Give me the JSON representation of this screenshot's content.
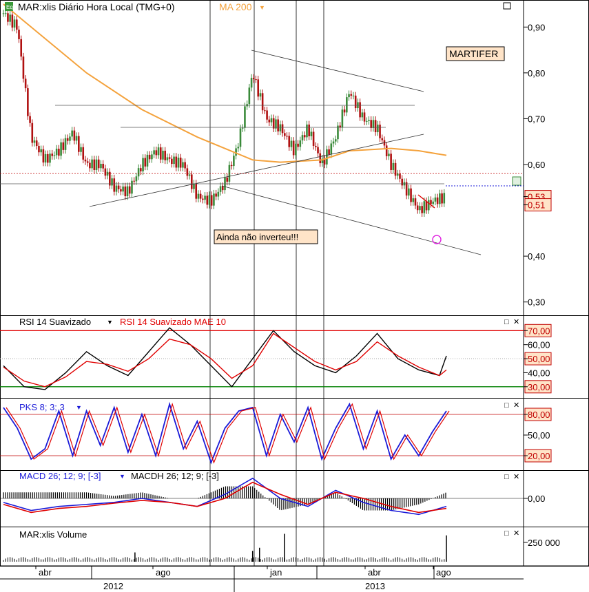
{
  "colors": {
    "background": "#ffffff",
    "axis": "#000000",
    "ma_line": "#f4a23c",
    "rsi": "#000000",
    "rsi_ma": "#e00000",
    "stoch_k": "#1a1ad8",
    "stoch_d": "#e00000",
    "macd": "#1a1ad8",
    "macd_signal": "#e00000",
    "level_high": "#e00000",
    "level_low": "#008000",
    "label_box": "#ffe4c8",
    "up_candle": "#3a8a3a",
    "down_candle": "#b01010"
  },
  "header": {
    "badge": "Eq",
    "title": "MAR:xlis Diário Hora Local (TMG+0)",
    "ma_label": "MA 200",
    "ticker_label": "MARTIFER",
    "note_label": "Ainda não inverteu!!!"
  },
  "panels": {
    "rsi": {
      "label1": "RSI 14 Suavizado",
      "label2": "RSI 14 Suavizado MAE 10"
    },
    "stoch": {
      "label": "PKS 8; 3; 3"
    },
    "macd": {
      "label1": "MACD 26; 12; 9; [-3]",
      "label2": "MACDH 26; 12; 9; [-3]"
    },
    "volume": {
      "label": "MAR:xlis Volume"
    }
  },
  "x_axis": {
    "months": [
      "abr",
      "ago",
      "jan",
      "abr",
      "ago"
    ],
    "years": [
      "2012",
      "2013"
    ]
  },
  "chart_data": [
    {
      "type": "candlestick",
      "title": "MAR:xlis Diário Hora Local (TMG+0)",
      "ylim": [
        0.28,
        0.95
      ],
      "y_ticks": [
        "0,90",
        "0,80",
        "0,70",
        "0,60",
        "0,40",
        "0,30"
      ],
      "price_tags": [
        "0,53",
        "0,51"
      ],
      "last_close": 0.53,
      "series": [
        {
          "name": "MA 200",
          "x": [
            0,
            20,
            60,
            100,
            140,
            180,
            200,
            230,
            250,
            280,
            300,
            320
          ],
          "values": [
            0.95,
            0.9,
            0.8,
            0.72,
            0.66,
            0.61,
            0.605,
            0.61,
            0.63,
            0.635,
            0.63,
            0.62
          ]
        }
      ],
      "close_approx": {
        "x": [
          0,
          10,
          20,
          30,
          40,
          50,
          60,
          70,
          80,
          90,
          100,
          110,
          120,
          130,
          140,
          150,
          160,
          170,
          180,
          190,
          200,
          210,
          220,
          230,
          240,
          250,
          260,
          270,
          280,
          290,
          300,
          310,
          320
        ],
        "values": [
          0.93,
          0.9,
          0.66,
          0.61,
          0.63,
          0.67,
          0.6,
          0.6,
          0.55,
          0.54,
          0.6,
          0.63,
          0.61,
          0.6,
          0.53,
          0.52,
          0.56,
          0.65,
          0.8,
          0.7,
          0.68,
          0.63,
          0.68,
          0.6,
          0.66,
          0.76,
          0.7,
          0.68,
          0.6,
          0.55,
          0.5,
          0.52,
          0.53
        ]
      }
    },
    {
      "type": "line",
      "title": "RSI 14 Suavizado",
      "ylim": [
        25,
        78
      ],
      "y_ticks": [
        "70,00",
        "60,00",
        "50,00",
        "40,00",
        "30,00"
      ],
      "levels": [
        70,
        30
      ],
      "series": [
        {
          "name": "RSI 14 Suavizado",
          "x": [
            0,
            15,
            30,
            45,
            60,
            75,
            90,
            105,
            120,
            135,
            150,
            165,
            180,
            195,
            210,
            225,
            240,
            255,
            270,
            285,
            300,
            315,
            320
          ],
          "values": [
            45,
            30,
            28,
            40,
            55,
            45,
            38,
            55,
            72,
            60,
            45,
            30,
            50,
            70,
            55,
            45,
            40,
            52,
            68,
            50,
            42,
            38,
            52
          ]
        },
        {
          "name": "RSI 14 Suavizado MAE 10",
          "x": [
            0,
            15,
            30,
            45,
            60,
            75,
            90,
            105,
            120,
            135,
            150,
            165,
            180,
            195,
            210,
            225,
            240,
            255,
            270,
            285,
            300,
            315,
            320
          ],
          "values": [
            44,
            34,
            30,
            37,
            48,
            46,
            41,
            50,
            64,
            60,
            50,
            36,
            45,
            68,
            58,
            48,
            42,
            48,
            62,
            52,
            44,
            38,
            42
          ]
        }
      ]
    },
    {
      "type": "line",
      "title": "PKS 8; 3; 3",
      "ylim": [
        5,
        98
      ],
      "y_ticks": [
        "80,00",
        "50,00",
        "20,00"
      ],
      "levels": [
        80,
        20
      ],
      "series": [
        {
          "name": "PKS 8; 3; 3",
          "x": [
            0,
            10,
            20,
            30,
            40,
            50,
            60,
            70,
            80,
            90,
            100,
            110,
            120,
            130,
            140,
            150,
            160,
            170,
            180,
            190,
            200,
            210,
            220,
            230,
            240,
            250,
            260,
            270,
            280,
            290,
            300,
            310,
            320
          ],
          "values": [
            90,
            60,
            15,
            30,
            85,
            20,
            85,
            35,
            90,
            25,
            80,
            20,
            95,
            30,
            70,
            10,
            60,
            85,
            90,
            20,
            80,
            40,
            90,
            15,
            60,
            95,
            30,
            85,
            15,
            50,
            20,
            55,
            85
          ]
        }
      ]
    },
    {
      "type": "line",
      "title": "MACD 26; 12; 9; [-3]",
      "ylim": [
        -0.06,
        0.06
      ],
      "y_ticks": [
        "0,00"
      ],
      "series": [
        {
          "name": "MACD 26; 12; 9; [-3]",
          "x": [
            0,
            20,
            40,
            60,
            80,
            100,
            120,
            140,
            160,
            180,
            200,
            220,
            240,
            260,
            280,
            300,
            320
          ],
          "values": [
            -0.01,
            -0.03,
            -0.02,
            -0.015,
            -0.01,
            0.0,
            -0.01,
            -0.02,
            0.01,
            0.05,
            0.0,
            -0.02,
            0.02,
            -0.01,
            -0.03,
            -0.04,
            -0.02
          ]
        },
        {
          "name": "MACDH 26; 12; 9; [-3]",
          "x": [
            0,
            20,
            40,
            60,
            80,
            100,
            120,
            140,
            160,
            180,
            200,
            220,
            240,
            260,
            280,
            300,
            320
          ],
          "values": [
            -0.015,
            -0.035,
            -0.025,
            -0.02,
            -0.012,
            -0.005,
            -0.01,
            -0.02,
            0.0,
            0.04,
            0.01,
            -0.015,
            0.015,
            0.0,
            -0.02,
            -0.035,
            -0.025
          ]
        }
      ]
    },
    {
      "type": "bar",
      "title": "MAR:xlis Volume",
      "ylim": [
        0,
        400000
      ],
      "y_ticks": [
        "250 000"
      ],
      "spikes": {
        "x": [
          95,
          180,
          185,
          203,
          320
        ],
        "values": [
          120000,
          140000,
          180000,
          360000,
          340000
        ]
      }
    }
  ]
}
